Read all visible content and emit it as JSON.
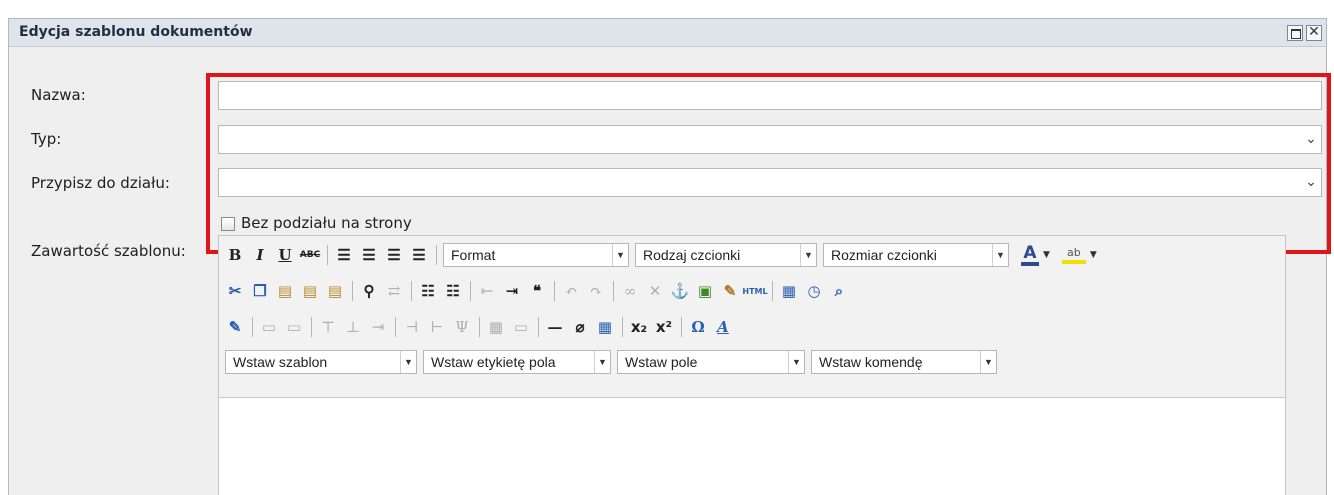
{
  "window": {
    "title": "Edycja szablonu dokumentów"
  },
  "form": {
    "name_label": "Nazwa:",
    "type_label": "Typ:",
    "dept_label": "Przypisz do działu:",
    "no_split_label": "Bez podziału na strony",
    "content_label": "Zawartość szablonu:",
    "name_value": "",
    "type_value": "",
    "dept_value": ""
  },
  "toolbar": {
    "format": "Format",
    "font_family": "Rodzaj czcionki",
    "font_size": "Rozmiar czcionki",
    "insert_template": "Wstaw szablon",
    "insert_field_label": "Wstaw etykietę pola",
    "insert_field": "Wstaw pole",
    "insert_command": "Wstaw komendę"
  },
  "colors": {
    "highlight": "#e0151a",
    "title_bg": "#dfe4ea",
    "panel_bg": "#efefef"
  }
}
